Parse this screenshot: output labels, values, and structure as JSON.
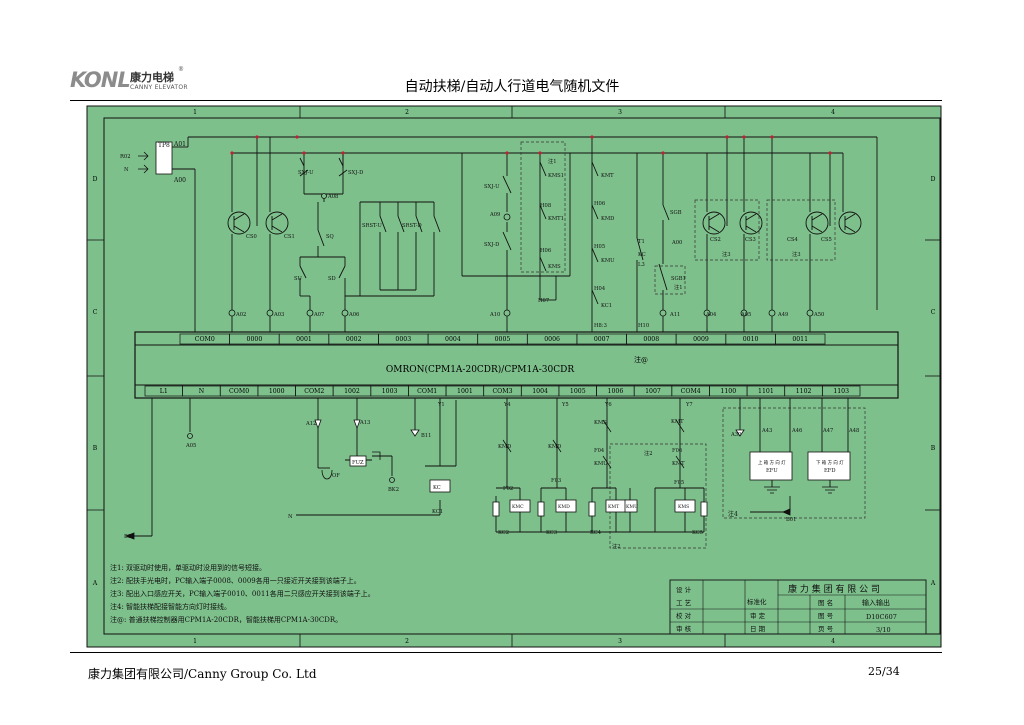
{
  "header": {
    "logo_mark": "KONL",
    "logo_cn": "康力电梯",
    "logo_en": "CANNY ELEVATOR",
    "logo_reg": "®",
    "doc_title": "自动扶梯/自动人行道电气随机文件"
  },
  "footer": {
    "company": "康力集团有限公司/Canny Group Co. Ltd",
    "page": "25/34"
  },
  "frame": {
    "col_numbers": [
      "1",
      "2",
      "3",
      "4"
    ],
    "row_letters": [
      "D",
      "C",
      "B",
      "A"
    ]
  },
  "colors": {
    "sheet_green": "#7ec08c",
    "line": "#111111",
    "dashed": "#333333"
  },
  "plc": {
    "model": "OMRON(CPM1A-20CDR)/CPM1A-30CDR",
    "note": "注@",
    "input_terminals": [
      "COM0",
      "0000",
      "0001",
      "0002",
      "0003",
      "0004",
      "0005",
      "0006",
      "0007",
      "0008",
      "0009",
      "0010",
      "0011"
    ],
    "output_terminals": [
      "L1",
      "N",
      "COM0",
      "1000",
      "COM2",
      "1002",
      "1003",
      "COM1",
      "1001",
      "COM3",
      "1004",
      "1005",
      "1006",
      "1007",
      "COM4",
      "1100",
      "1101",
      "1102",
      "1103"
    ]
  },
  "labels": {
    "tp8": "TP8",
    "a01": "A01",
    "a00": "A00",
    "r02": "R02",
    "n_left": "N",
    "sxj_u": "SXJ-U",
    "sxj_d": "SXJ-D",
    "a08": "A08",
    "cs0": "CS0",
    "cs1": "CS1",
    "sq": "SQ",
    "su": "SU",
    "sd": "SD",
    "srst_u": "SRST-U",
    "srst_d": "SRST-D",
    "a02": "A02",
    "a03": "A03",
    "a07": "A07",
    "a06": "A06",
    "sxj_u2": "SXJ-U",
    "a09": "A09",
    "sxj_d2": "SXJ-D",
    "a10": "A10",
    "kms1": "KMS1",
    "kmt1": "KMT1",
    "kms": "KMS",
    "kmt": "KMT",
    "kmd": "KMD",
    "kmu": "KMU",
    "kc1": "KC1",
    "h08": "H08",
    "h06": "H06",
    "h05": "H05",
    "h04": "H04",
    "h07": "H07",
    "h8_3": "H8:3",
    "h10": "H10",
    "note1": "注1",
    "t1": "T1",
    "kc": "KC",
    "l3": "L3",
    "a00b": "A00",
    "sgb": "SGB",
    "sgb1": "SGB1",
    "note1b": "注1",
    "cs2": "CS2",
    "cs3": "CS3",
    "cs4": "CS4",
    "cs5": "CS5",
    "note3": "注3",
    "note3b": "注3",
    "a11": "A11",
    "a04": "A04",
    "a05": "A05",
    "a49": "A49",
    "a50": "A50",
    "a05b": "A05",
    "a12": "A12",
    "a13": "A13",
    "b11": "B11",
    "fuz": "FUZ",
    "of": "OF",
    "bk2": "BK2",
    "b01": "B01",
    "n_mid": "N",
    "kc_coil": "KC",
    "kc1b": "KC1",
    "y1": "Y1",
    "y4": "Y4",
    "y5": "Y5",
    "y6": "Y6",
    "y7": "Y7",
    "kmd2": "KMD",
    "kmd3": "KMD",
    "kms2": "KMS",
    "kmt2": "KMT",
    "f02": "F02",
    "f03": "F03",
    "f04": "F04",
    "f05": "F05",
    "f06": "F06",
    "kmu2": "KMU",
    "kmt3": "KMT",
    "kmc": "KMC",
    "kmd4": "KMD",
    "kmt4": "KMT",
    "kmu4": "KMU",
    "kms4": "KMS",
    "kc2": "KC2",
    "kc3": "KC3",
    "kc4": "KC4",
    "kc5": "KC5",
    "note2": "注2",
    "note2b": "注2",
    "a30": "A30",
    "a43": "A43",
    "a46": "A46",
    "a47": "A47",
    "a48": "A48",
    "efu": "EFU",
    "efd": "EFD",
    "efu_title": "上 箱 方 向 灯",
    "efd_title": "下 箱 方 向 灯",
    "note4": "注4",
    "b01b": "B01",
    "b04": "B04"
  },
  "notes": [
    "注1: 双驱动时使用，单驱动时没用到的信号短接。",
    "注2: 配扶手光电时，PC输入端子0008、0009各用一只接近开关接到该端子上。",
    "注3: 配出入口感应开关，PC输入端子0010、0011各用二只感应开关接到该端子上。",
    "注4: 智能扶梯配接智能方向灯时接线。",
    "注@: 普通扶梯控制器用CPM1A-20CDR，智能扶梯用CPM1A-30CDR。"
  ],
  "title_block": {
    "company": "康 力 集 团 有 限 公 司",
    "design": "设 计",
    "craft": "工 艺",
    "check": "校 对",
    "audit": "审 核",
    "standard": "标准化",
    "review": "审 定",
    "date": "日 期",
    "drawing_name_label": "图 名",
    "drawing_name": "输入输出",
    "drawing_no_label": "图 号",
    "drawing_no": "D10C607",
    "page_label": "页 号",
    "page": "3/10"
  }
}
